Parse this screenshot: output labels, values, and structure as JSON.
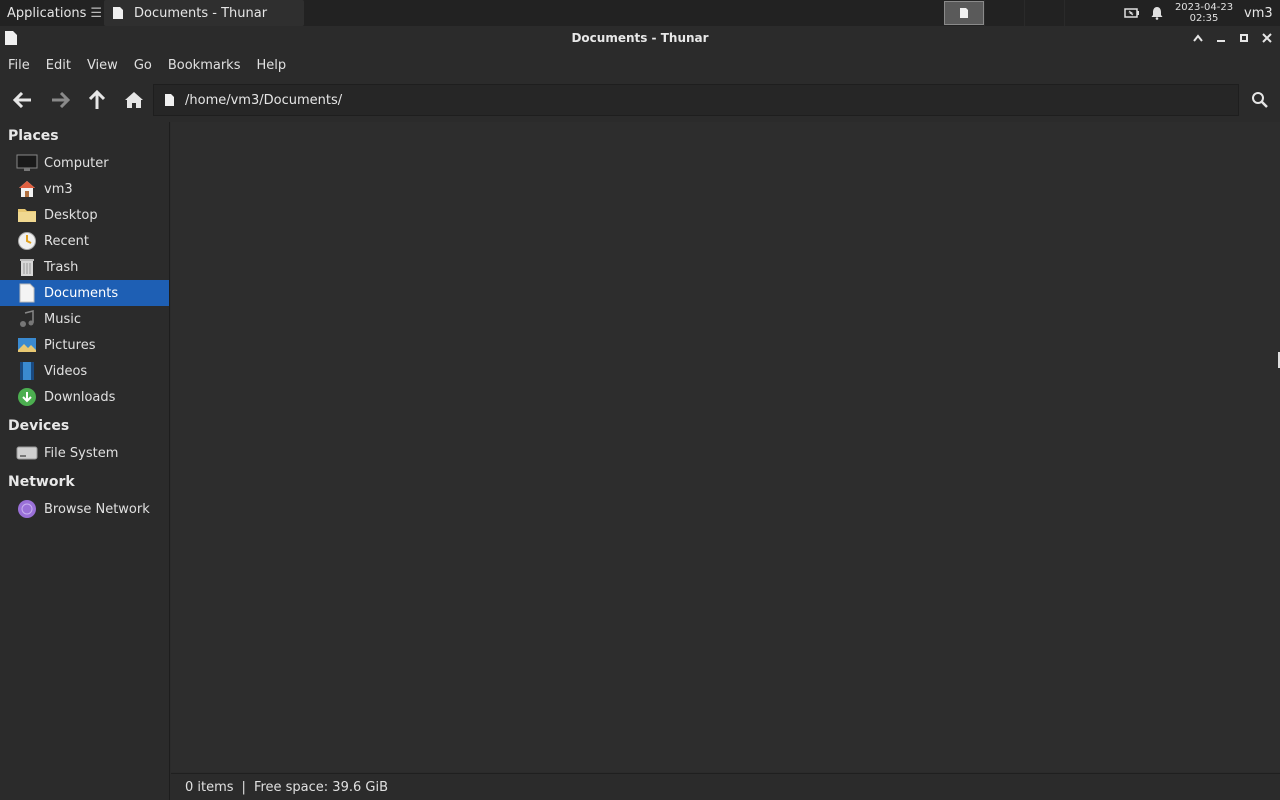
{
  "panel": {
    "apps_label": "Applications",
    "task_title": "Documents - Thunar",
    "clock_date": "2023-04-23",
    "clock_time": "02:35",
    "user": "vm3"
  },
  "window": {
    "title": "Documents - Thunar"
  },
  "menubar": {
    "file": "File",
    "edit": "Edit",
    "view": "View",
    "go": "Go",
    "bookmarks": "Bookmarks",
    "help": "Help"
  },
  "location": {
    "path": "/home/vm3/Documents/"
  },
  "sidebar": {
    "places_title": "Places",
    "places": [
      {
        "label": "Computer",
        "icon": "computer-icon"
      },
      {
        "label": "vm3",
        "icon": "home-icon"
      },
      {
        "label": "Desktop",
        "icon": "desktop-folder-icon"
      },
      {
        "label": "Recent",
        "icon": "recent-clock-icon"
      },
      {
        "label": "Trash",
        "icon": "trash-icon"
      },
      {
        "label": "Documents",
        "icon": "documents-icon",
        "active": true
      },
      {
        "label": "Music",
        "icon": "music-icon"
      },
      {
        "label": "Pictures",
        "icon": "pictures-icon"
      },
      {
        "label": "Videos",
        "icon": "videos-icon"
      },
      {
        "label": "Downloads",
        "icon": "downloads-icon"
      }
    ],
    "devices_title": "Devices",
    "devices": [
      {
        "label": "File System",
        "icon": "drive-icon"
      }
    ],
    "network_title": "Network",
    "network": [
      {
        "label": "Browse Network",
        "icon": "network-icon"
      }
    ]
  },
  "status": {
    "items": "0 items",
    "separator": "|",
    "free_space": "Free space: 39.6 GiB"
  },
  "colors": {
    "selection": "#1e5fb4",
    "background": "#2b2b2b"
  }
}
